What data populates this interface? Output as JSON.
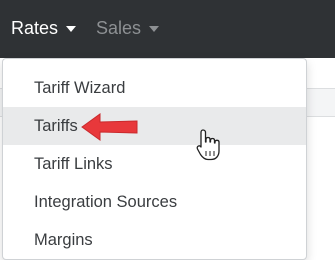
{
  "navbar": {
    "items": [
      {
        "label": "Rates",
        "state": "open",
        "caret_icon": "caret-down-icon"
      },
      {
        "label": "Sales",
        "state": "inactive",
        "caret_icon": "caret-down-icon"
      }
    ]
  },
  "dropdown": {
    "items": [
      {
        "label": "Tariff Wizard",
        "highlighted": false
      },
      {
        "label": "Tariffs",
        "highlighted": true
      },
      {
        "label": "Tariff Links",
        "highlighted": false
      },
      {
        "label": "Integration Sources",
        "highlighted": false
      },
      {
        "label": "Margins",
        "highlighted": false
      }
    ]
  },
  "annotation": {
    "arrow_icon": "red-arrow-left-icon",
    "arrow_color": "#e8383b",
    "cursor_icon": "hand-pointer-icon"
  },
  "colors": {
    "navbar_bg": "#2f3235",
    "nav_active_text": "#ffffff",
    "nav_inactive_text": "#8d9093",
    "menu_hover_bg": "#e9eaeb"
  }
}
